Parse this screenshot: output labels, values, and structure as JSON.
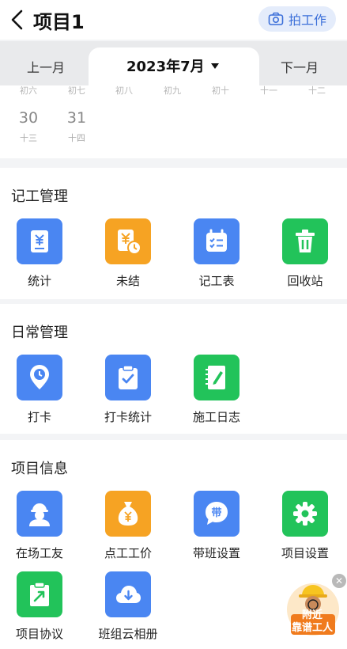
{
  "header": {
    "title": "项目1",
    "photo_label": "拍工作"
  },
  "monthbar": {
    "prev": "上一月",
    "current": "2023年7月",
    "next": "下一月"
  },
  "calendar": {
    "lunar_row": [
      "初六",
      "初七",
      "初八",
      "初九",
      "初十",
      "十一",
      "十二"
    ],
    "days": [
      {
        "day": "30",
        "lunar": "十三"
      },
      {
        "day": "31",
        "lunar": "十四"
      }
    ]
  },
  "sections": [
    {
      "title": "记工管理",
      "items": [
        {
          "label": "统计",
          "icon": "yuan-doc-icon",
          "color": "#4a86f2"
        },
        {
          "label": "未结",
          "icon": "yuan-clock-icon",
          "color": "#f6a323"
        },
        {
          "label": "记工表",
          "icon": "calendar-check-icon",
          "color": "#4a86f2"
        },
        {
          "label": "回收站",
          "icon": "trash-icon",
          "color": "#22c35a"
        }
      ]
    },
    {
      "title": "日常管理",
      "items": [
        {
          "label": "打卡",
          "icon": "location-clock-icon",
          "color": "#4a86f2"
        },
        {
          "label": "打卡统计",
          "icon": "clipboard-check-icon",
          "color": "#4a86f2"
        },
        {
          "label": "施工日志",
          "icon": "notebook-pen-icon",
          "color": "#22c35a"
        }
      ]
    },
    {
      "title": "项目信息",
      "items": [
        {
          "label": "在场工友",
          "icon": "worker-icon",
          "color": "#4a86f2"
        },
        {
          "label": "点工工价",
          "icon": "money-bag-icon",
          "color": "#f6a323"
        },
        {
          "label": "带班设置",
          "icon": "dai-badge-icon",
          "color": "#4a86f2"
        },
        {
          "label": "项目设置",
          "icon": "gear-icon",
          "color": "#22c35a"
        },
        {
          "label": "项目协议",
          "icon": "agreement-icon",
          "color": "#22c35a"
        },
        {
          "label": "班组云相册",
          "icon": "cloud-download-icon",
          "color": "#4a86f2"
        }
      ]
    }
  ],
  "float_ad": {
    "line1": "附近",
    "line2": "靠谱工人"
  }
}
